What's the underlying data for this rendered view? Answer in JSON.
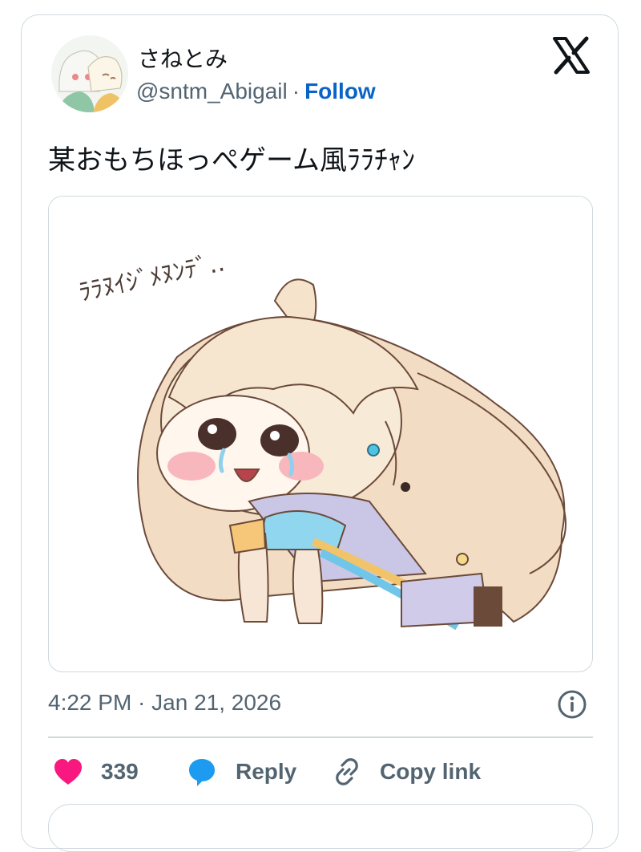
{
  "author": {
    "display_name": "さねとみ",
    "handle": "@sntm_Abigail",
    "separator": "·",
    "follow_label": "Follow"
  },
  "tweet": {
    "text": "某おもちほっぺゲーム風ﾗﾗﾁｬﾝ",
    "image_caption": "ﾗﾗﾇｲｼﾞﾒﾇﾝﾃﾞ‥",
    "timestamp": "4:22 PM · Jan 21, 2026"
  },
  "actions": {
    "like_count": "339",
    "reply_label": "Reply",
    "copy_link_label": "Copy link"
  },
  "colors": {
    "follow": "#0a64c7",
    "like_heart": "#f91880",
    "reply_bubble": "#1d9bf0",
    "muted_text": "#536471",
    "border": "#cfd9de"
  },
  "icons": [
    "x-logo-icon",
    "info-icon",
    "heart-icon",
    "reply-bubble-icon",
    "link-icon"
  ]
}
